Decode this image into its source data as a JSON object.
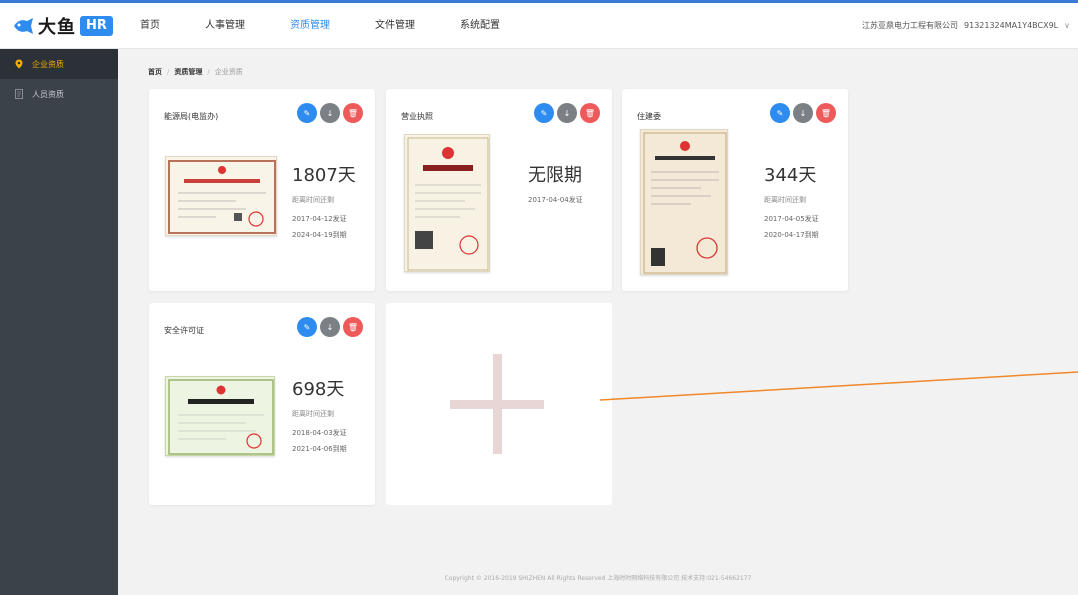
{
  "brand": {
    "name": "大鱼",
    "badge": "HR"
  },
  "nav": [
    {
      "label": "首页",
      "active": false
    },
    {
      "label": "人事管理",
      "active": false
    },
    {
      "label": "资质管理",
      "active": true
    },
    {
      "label": "文件管理",
      "active": false
    },
    {
      "label": "系统配置",
      "active": false
    }
  ],
  "company": {
    "name": "江苏亚鼎电力工程有限公司",
    "code": "91321324MA1Y4BCX9L",
    "caret": "∨"
  },
  "sidebar": {
    "items": [
      {
        "label": "企业资质",
        "active": true
      },
      {
        "label": "人员资质",
        "active": false
      }
    ]
  },
  "breadcrumb": {
    "home": "首页",
    "section": "资质管理",
    "current": "企业资质"
  },
  "cards": [
    {
      "title": "能源局(电监办)",
      "days": "1807天",
      "note": "距离时间还剩",
      "issued": "2017-04-12发证",
      "expires": "2024-04-19到期"
    },
    {
      "title": "营业执照",
      "days": "无限期",
      "note": "",
      "issued": "2017-04-04发证",
      "expires": ""
    },
    {
      "title": "住建委",
      "days": "344天",
      "note": "距离时间还剩",
      "issued": "2017-04-05发证",
      "expires": "2020-04-17到期"
    },
    {
      "title": "安全许可证",
      "days": "698天",
      "note": "距离时间还剩",
      "issued": "2018-04-03发证",
      "expires": "2021-04-06到期"
    }
  ],
  "actions": {
    "edit": "✎",
    "download": "↓",
    "delete": "🗑"
  },
  "footer": "Copyright © 2016-2019 SHIZHEN All Rights Reserved 上海时时网络科技有限公司 技术支持:021-54662177",
  "colors": {
    "accent": "#2e8cf0",
    "sidebar": "#3c4249",
    "danger": "#ee5a5a",
    "annotation": "#f0882a"
  }
}
